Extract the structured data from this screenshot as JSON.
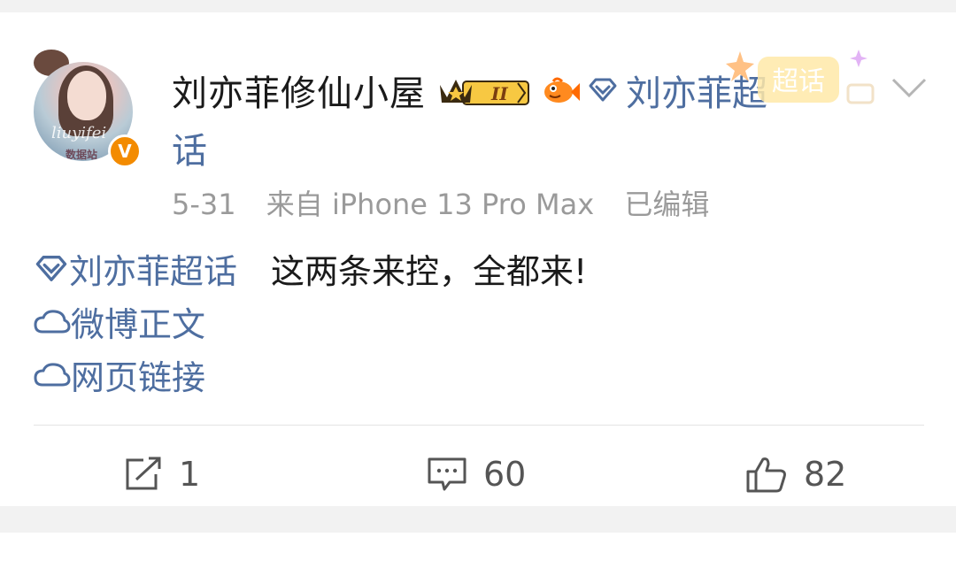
{
  "post": {
    "username": "刘亦菲修仙小屋",
    "topic_badge_label": "刘亦菲超",
    "topic_badge_wrap": "话",
    "date": "5-31",
    "source": "来自 iPhone 13 Pro Max",
    "edited": "已编辑",
    "avatar_watermark": "liuyifei",
    "avatar_caption": "数据站",
    "verified_badge": "V",
    "deco_text": "超话",
    "level_badge": "II",
    "body": {
      "topic": "刘亦菲超话",
      "text": "这两条来控，全都来!",
      "link1": "微博正文",
      "link2": "网页链接"
    }
  },
  "actions": {
    "repost_count": "1",
    "comment_count": "60",
    "like_count": "82"
  },
  "icons": [
    "crown-level-icon",
    "fish-icon",
    "diamond-topic-icon",
    "chevron-down-icon",
    "cloud-link-icon",
    "repost-icon",
    "comment-icon",
    "like-icon"
  ],
  "colors": {
    "link": "#4e6ea0",
    "verified": "#f38b00",
    "background": "#f2f2f2"
  }
}
